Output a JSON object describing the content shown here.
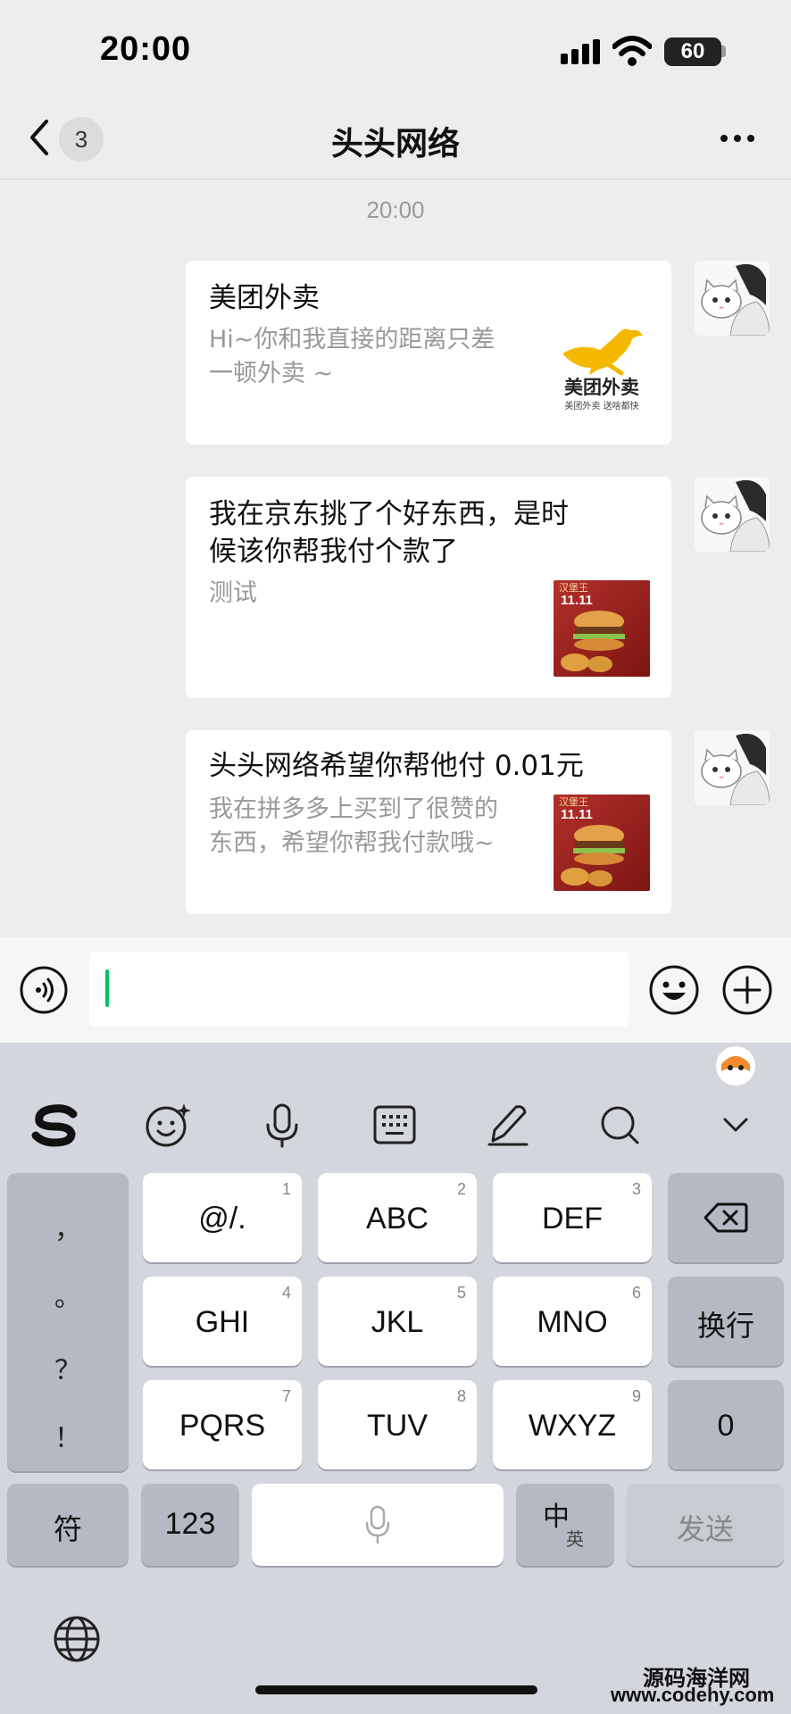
{
  "status_bar": {
    "time": "20:00",
    "battery": "60"
  },
  "nav": {
    "back_badge": "3",
    "title": "头头网络"
  },
  "chat": {
    "timestamp": "20:00",
    "messages": [
      {
        "title": "美团外卖",
        "desc_lines": [
          "Hi~你和我直接的距离只差",
          "一顿外卖 ~"
        ],
        "thumb_logo_text": "美团外卖",
        "thumb_slogan": "美团外卖 送啥都快"
      },
      {
        "title_lines": [
          "我在京东挑了个好东西，是时",
          "候该你帮我付个款了"
        ],
        "desc": "测试",
        "thumb_tag": "11.11",
        "thumb_brand": "汉堡王"
      },
      {
        "title": "头头网络希望你帮他付 0.01元",
        "desc_lines": [
          "我在拼多多上买到了很赞的",
          "东西，希望你帮我付款哦~"
        ],
        "thumb_tag": "11.11",
        "thumb_brand": "汉堡王"
      }
    ]
  },
  "keyboard": {
    "toolbar": [
      "sogou-logo",
      "emoji-icon",
      "microphone-icon",
      "keyboard-icon",
      "pen-icon",
      "search-icon",
      "chevron-down-icon"
    ],
    "punct": [
      "，",
      "。",
      "？",
      "！"
    ],
    "keys": [
      {
        "label": "@/.",
        "num": "1"
      },
      {
        "label": "ABC",
        "num": "2"
      },
      {
        "label": "DEF",
        "num": "3"
      },
      {
        "label": "GHI",
        "num": "4"
      },
      {
        "label": "JKL",
        "num": "5"
      },
      {
        "label": "MNO",
        "num": "6"
      },
      {
        "label": "PQRS",
        "num": "7"
      },
      {
        "label": "TUV",
        "num": "8"
      },
      {
        "label": "WXYZ",
        "num": "9"
      }
    ],
    "newline": "换行",
    "zero": "0",
    "symbols": "符",
    "numbers": "123",
    "lang_main": "中",
    "lang_sub": "英",
    "send": "发送"
  },
  "watermark": {
    "line1": "源码海洋网",
    "line2": "www.codehy.com"
  }
}
